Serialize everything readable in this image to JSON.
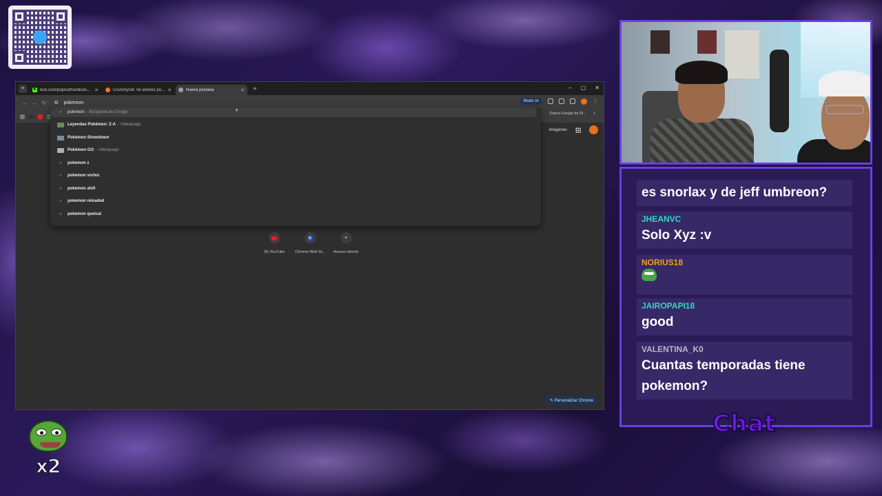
{
  "browser": {
    "tabs": [
      {
        "title": "kick.com/popout/hardnoise/ch",
        "favicon_color": "#53fc18",
        "favicon_glyph": "K",
        "active": false
      },
      {
        "title": "Crunchyroll: Ve animes popular",
        "favicon_color": "#f47521",
        "favicon_glyph": "",
        "active": false
      },
      {
        "title": "Nueva pestaña",
        "favicon_color": "#9aa0a6",
        "favicon_glyph": "",
        "active": true
      }
    ],
    "new_tab_glyph": "+",
    "window_controls": [
      "–",
      "▢",
      "✕"
    ],
    "omnibox_value": "pokmeon",
    "modo_ia_label": "Modo IA",
    "bookmark_right": [
      "Dance Emojis for Di...",
      "»"
    ],
    "suggestions": [
      {
        "type": "search",
        "main": "pokmeon",
        "sub": "- Búsqueda de Google"
      },
      {
        "type": "entity",
        "main": "Leyendas Pokémon: Z-A",
        "sub": "- Videojuego",
        "thumb_color": "#6a8a5a"
      },
      {
        "type": "entity",
        "main": "Pokémon Showdown",
        "sub": "",
        "thumb_color": "#7a8a9a"
      },
      {
        "type": "entity",
        "main": "Pokémon GO",
        "sub": "- Videojuego",
        "thumb_color": "#b0b0b0"
      },
      {
        "type": "search",
        "main": "pokemon z",
        "sub": ""
      },
      {
        "type": "search",
        "main": "pokemon vortex",
        "sub": ""
      },
      {
        "type": "search",
        "main": "pokemon ahill",
        "sub": ""
      },
      {
        "type": "search",
        "main": "pokemon reloaded",
        "sub": ""
      },
      {
        "type": "search",
        "main": "pokemon quetzal",
        "sub": ""
      }
    ],
    "ntp_images_label": "Imágenes",
    "shortcuts": [
      {
        "label": "(5) YouTube",
        "icon": "youtube-icon"
      },
      {
        "label": "Chrome Web St...",
        "icon": "chrome-web-store-icon"
      },
      {
        "label": "Acceso directo",
        "icon": "add-shortcut-icon"
      }
    ],
    "customize_label": "Personalizar Chrome"
  },
  "chat": {
    "messages": [
      {
        "user": "",
        "user_color": "#ffffff",
        "text": "es snorlax y de jeff umbreon?"
      },
      {
        "user": "JHEANVC",
        "user_color": "#33d6c3",
        "text": "Solo Xyz :v"
      },
      {
        "user": "NORIUS18",
        "user_color": "#f0a020",
        "text": "",
        "emote": "pepe-emote"
      },
      {
        "user": "JAIROPAPI18",
        "user_color": "#33d6c3",
        "text": "good"
      },
      {
        "user": "VALENTINA_K0",
        "user_color": "#b8b8c8",
        "text": "Cuantas temporadas tiene pokemon?"
      }
    ],
    "title": "Chat"
  },
  "overlay": {
    "multiplier": "x2"
  },
  "colors": {
    "accent_purple": "#6a3fe0",
    "chrome_dark": "#2e2e2e"
  }
}
